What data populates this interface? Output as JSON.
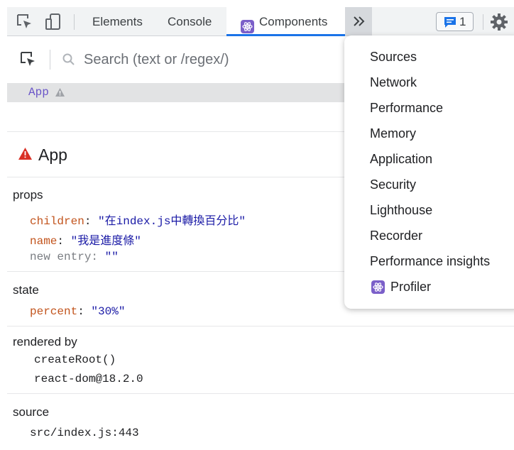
{
  "toolbar": {
    "tabs": [
      "Elements",
      "Console",
      "Components"
    ],
    "issues_count": "1"
  },
  "search": {
    "placeholder": "Search (text or /regex/)"
  },
  "tree": {
    "selected": "App"
  },
  "component": {
    "title": "App"
  },
  "props": {
    "label": "props",
    "items": [
      {
        "key": "children",
        "value": "\"在index.js中轉換百分比\""
      },
      {
        "key": "name",
        "value": "\"我是進度條\""
      },
      {
        "key": "new entry",
        "value": "\"\""
      }
    ]
  },
  "state": {
    "label": "state",
    "items": [
      {
        "key": "percent",
        "value": "\"30%\""
      }
    ]
  },
  "rendered_by": {
    "label": "rendered by",
    "items": [
      "createRoot()",
      "react-dom@18.2.0"
    ]
  },
  "source": {
    "label": "source",
    "value": "src/index.js:443"
  },
  "menu": {
    "items": [
      "Sources",
      "Network",
      "Performance",
      "Memory",
      "Application",
      "Security",
      "Lighthouse",
      "Recorder",
      "Performance insights",
      "Profiler"
    ]
  },
  "colors": {
    "accent": "#1a73e8",
    "react_icon": "#7b5fc9",
    "error": "#d93025"
  }
}
